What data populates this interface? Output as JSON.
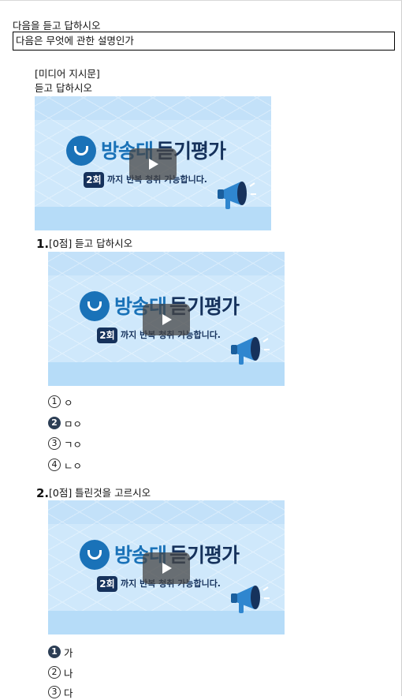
{
  "header": {
    "instruction": "다음을 듣고 답하시오",
    "question_box": "다음은 무엇에 관한 설명인가"
  },
  "media": {
    "label": "[미디어 지시문]",
    "instruction": "듣고 답하시오"
  },
  "video_thumbnail": {
    "brand_part1": "방송대",
    "brand_part2": "듣기평가",
    "badge": "2회",
    "subtitle": "까지 반복 청취 가능합니다.",
    "accent_color": "#1a72b8",
    "dark_color": "#16325c"
  },
  "questions": [
    {
      "number": "1.",
      "title": "[0점] 듣고 답하시오",
      "options": [
        {
          "marker": "1",
          "text": "ㅇ",
          "selected": false
        },
        {
          "marker": "2",
          "text": "ㅁㅇ",
          "selected": true
        },
        {
          "marker": "3",
          "text": "ㄱㅇ",
          "selected": false
        },
        {
          "marker": "4",
          "text": "ㄴㅇ",
          "selected": false
        }
      ]
    },
    {
      "number": "2.",
      "title": "[0점] 틀린것을 고르시오",
      "options": [
        {
          "marker": "1",
          "text": "가",
          "selected": true
        },
        {
          "marker": "2",
          "text": "나",
          "selected": false
        },
        {
          "marker": "3",
          "text": "다",
          "selected": false
        }
      ]
    }
  ]
}
